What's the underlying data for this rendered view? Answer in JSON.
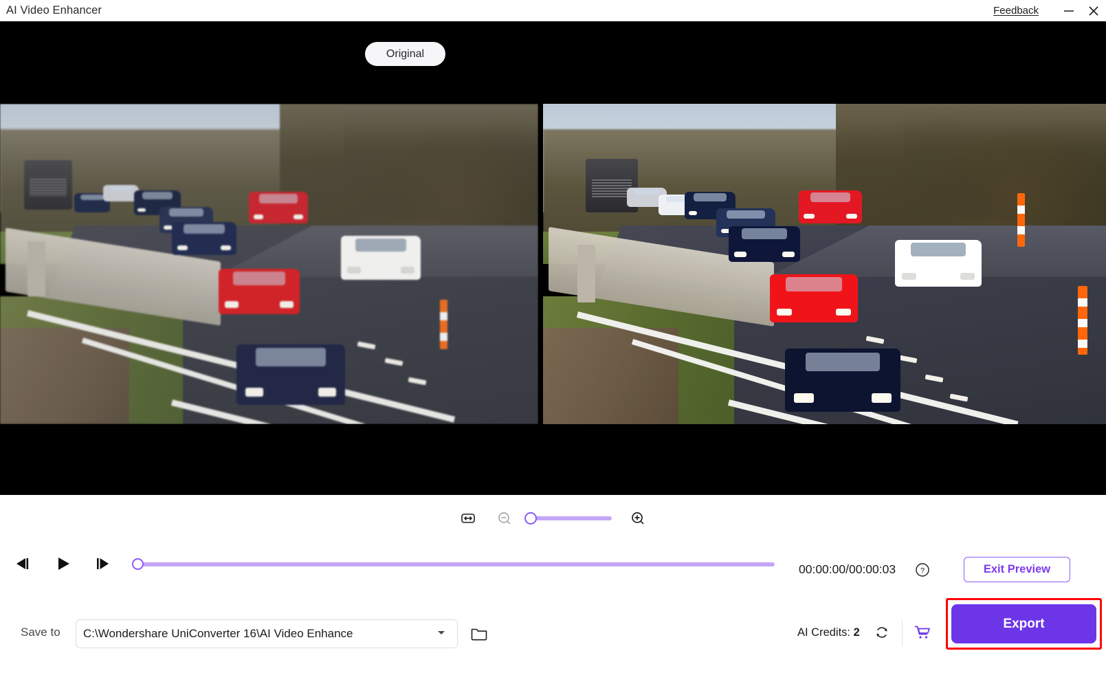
{
  "window": {
    "title": "AI Video Enhancer",
    "feedback_label": "Feedback",
    "minimize_icon": "minimize-icon",
    "close_icon": "close-icon"
  },
  "preview": {
    "badge_label": "Original",
    "left_pane_name": "original-video-pane",
    "right_pane_name": "enhanced-video-pane"
  },
  "zoom_controls": {
    "fit_icon": "fit-to-width-icon",
    "zoom_out_icon": "zoom-out-icon",
    "zoom_in_icon": "zoom-in-icon",
    "slider_value": 0
  },
  "playback": {
    "prev_frame_icon": "previous-frame-icon",
    "play_icon": "play-icon",
    "next_frame_icon": "next-frame-icon",
    "progress_value": 0,
    "time_display": "00:00:00/00:00:03",
    "help_icon": "help-circle-icon",
    "exit_preview_label": "Exit Preview"
  },
  "save": {
    "label": "Save to",
    "path": "C:\\Wondershare UniConverter 16\\AI Video Enhance",
    "dropdown_icon": "chevron-down-icon",
    "folder_icon": "folder-icon"
  },
  "footer": {
    "credits_label": "AI Credits:",
    "credits_value": "2",
    "refresh_icon": "refresh-icon",
    "cart_icon": "shopping-cart-icon",
    "export_label": "Export"
  },
  "colors": {
    "accent": "#6c36e8",
    "accent_light": "#c3a7f5",
    "accent_outline": "#8b5cf6",
    "highlight": "#ff0000",
    "stage_bg": "#000000"
  }
}
